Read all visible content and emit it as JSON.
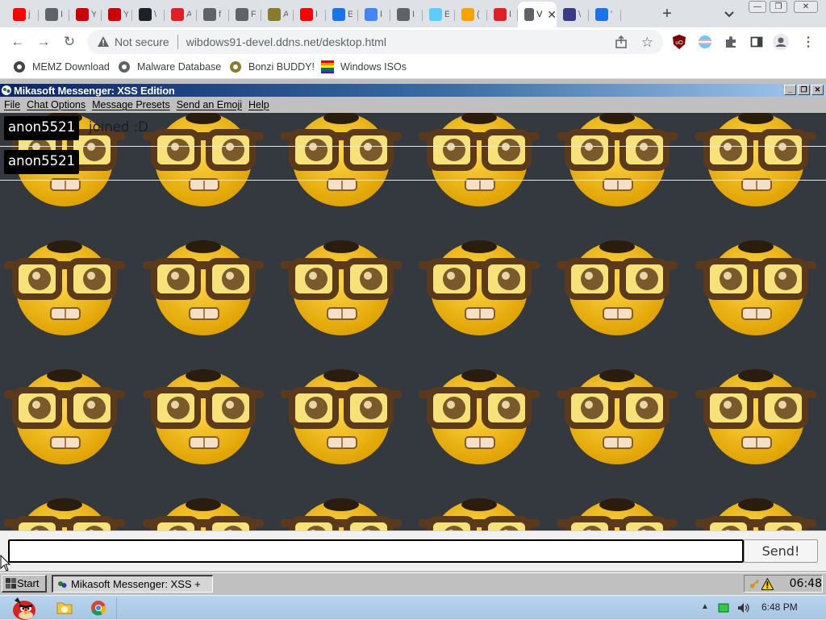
{
  "browser": {
    "tabs": [
      {
        "icon": "youtube-icon",
        "color": "#ff0000",
        "label": "j"
      },
      {
        "icon": "chrome-icon",
        "color": "#5f6368",
        "label": "I"
      },
      {
        "icon": "youtube-old-icon",
        "color": "#cc0000",
        "label": "Y"
      },
      {
        "icon": "youtube-old-icon",
        "color": "#cc0000",
        "label": "Y"
      },
      {
        "icon": "museum-icon",
        "color": "#202124",
        "label": "\\"
      },
      {
        "icon": "adobe-icon",
        "color": "#e01f26",
        "label": "A"
      },
      {
        "icon": "globe-icon",
        "color": "#5f6368",
        "label": "f"
      },
      {
        "icon": "globe-icon",
        "color": "#5f6368",
        "label": "F"
      },
      {
        "icon": "pencil-icon",
        "color": "#8a7a2c",
        "label": "A"
      },
      {
        "icon": "youtube-icon",
        "color": "#ff0000",
        "label": "I"
      },
      {
        "icon": "puzzle-icon",
        "color": "#1a73e8",
        "label": "E"
      },
      {
        "icon": "google-icon",
        "color": "#4285f4",
        "label": "I"
      },
      {
        "icon": "globe-icon",
        "color": "#5f6368",
        "label": "I"
      },
      {
        "icon": "trans-flag-icon",
        "color": "#5bcefa",
        "label": "E"
      },
      {
        "icon": "rainbow-icon",
        "color": "#f4a300",
        "label": "("
      },
      {
        "icon": "dislike-icon",
        "color": "#e01f26",
        "label": "I"
      },
      {
        "icon": "w-icon",
        "color": "#5f6368",
        "label": "V",
        "active": true
      },
      {
        "icon": "bonzi-icon",
        "color": "#3a3a8a",
        "label": "\\"
      },
      {
        "icon": "gear-icon",
        "color": "#1a73e8",
        "label": "'"
      }
    ],
    "new_tab_label": "+",
    "not_secure_label": "Not secure",
    "url": "wibdows91-devel.ddns.net/desktop.html",
    "bookmarks": [
      {
        "icon": "memz-icon",
        "label": "MEMZ Download"
      },
      {
        "icon": "globe-icon",
        "label": "Malware Database"
      },
      {
        "icon": "bonzi-icon",
        "label": "Bonzi BUDDY!"
      },
      {
        "icon": "windows-logo-icon",
        "label": "Windows ISOs"
      }
    ]
  },
  "app": {
    "window_title": "Mikasoft Messenger: XSS Edition",
    "menu": [
      "File",
      "Chat Options",
      "Message Presets",
      "Send an Emoji",
      "Help"
    ],
    "messages": [
      {
        "user": "anon5521",
        "text": "joined :D"
      },
      {
        "user": "anon5521",
        "text": ""
      }
    ],
    "background_emoji": "nerd-face-icon",
    "input_value": "",
    "send_label": "Send!",
    "taskbar": {
      "start_label": "Start",
      "task_label": "Mikasoft Messenger: XSS +",
      "clock": "06:48"
    }
  },
  "os": {
    "clock": "6:48 PM",
    "pinned": [
      "angry-bird-icon",
      "folder-icon",
      "chrome-icon"
    ]
  },
  "colors": {
    "titlebar_start": "#0a246a",
    "chat_bg": "#34383f",
    "nerd_yellow": "#f5c518",
    "glasses": "#5b3a1c"
  }
}
